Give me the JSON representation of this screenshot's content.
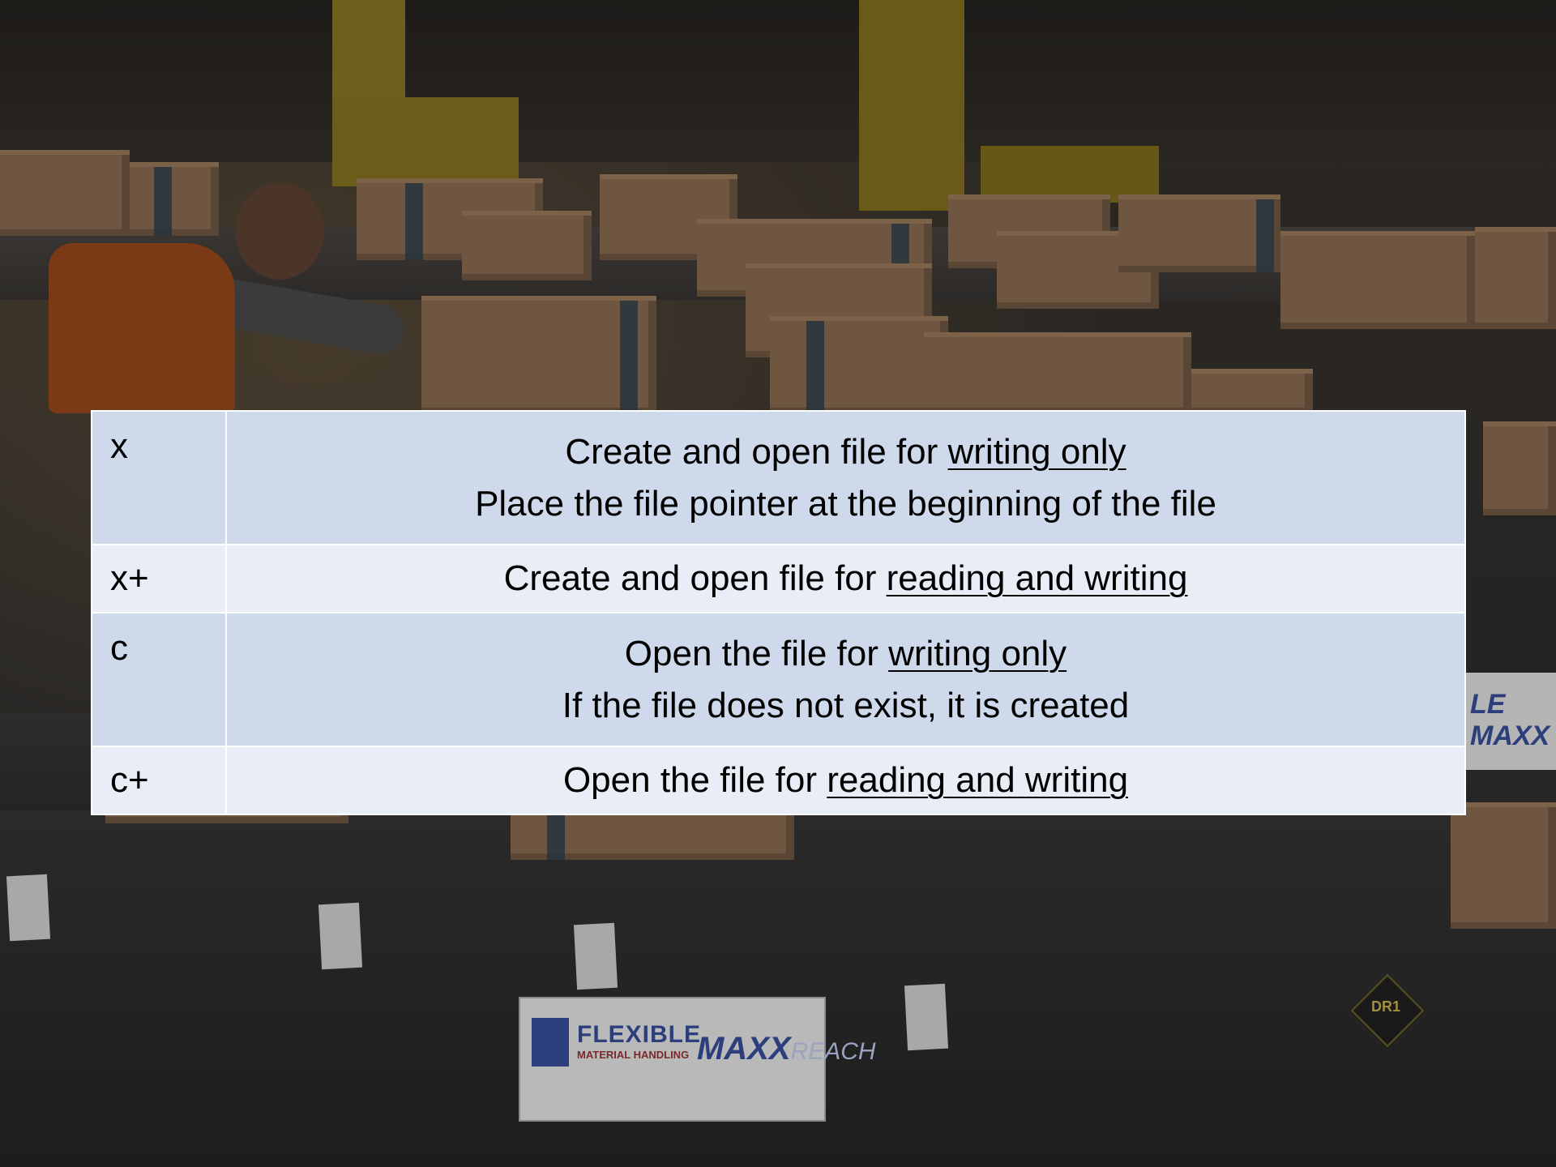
{
  "background": {
    "description_tag": "warehouse-conveyor-photo",
    "sign_main": "FLEXIBLE",
    "sign_sub": "MATERIAL HANDLING",
    "sign_brand_bold": "MAXX",
    "sign_brand_light": "REACH",
    "sign_right": "LE  MAXX",
    "tag_label": "DR1"
  },
  "table": {
    "rows": [
      {
        "mode": "x",
        "line1_prefix": "Create and open file for ",
        "line1_emph": "writing only",
        "line2": "Place the file pointer at the beginning of the file"
      },
      {
        "mode": "x+",
        "line1_prefix": "Create and open file for ",
        "line1_emph": "reading and writing"
      },
      {
        "mode": "c",
        "line1_prefix": "Open the file for ",
        "line1_emph": "writing only",
        "line2": "If the file does not exist, it is created"
      },
      {
        "mode": "c+",
        "line1_prefix": "Open the file for ",
        "line1_emph": "reading and writing"
      }
    ]
  }
}
